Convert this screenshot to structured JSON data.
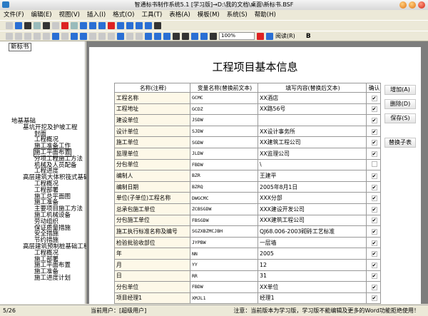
{
  "window": {
    "title": "智通标书制作系统5.1 [学习版]→D:\\我的文档\\桌面\\新标书.BSF"
  },
  "menu": [
    "文件(F)",
    "编辑(E)",
    "视图(V)",
    "插入(I)",
    "格式(O)",
    "工具(T)",
    "表格(A)",
    "模板(M)",
    "系统(S)",
    "帮助(H)"
  ],
  "toolbar": {
    "zoom": "100%",
    "read_label": "阅读(R)",
    "bold": "B"
  },
  "left": {
    "doc_tag": "新标书",
    "tree": [
      {
        "level": 1,
        "label": "地基基础"
      },
      {
        "level": 2,
        "label": "基坑开挖及护坡工程"
      },
      {
        "level": 3,
        "label": "封面"
      },
      {
        "level": 3,
        "label": "工程概况"
      },
      {
        "level": 3,
        "label": "施工准备工作"
      },
      {
        "level": 3,
        "label": "施工平面布置",
        "selected": true
      },
      {
        "level": 3,
        "label": "分项工程施工方法"
      },
      {
        "level": 3,
        "label": "机械及人员配备"
      },
      {
        "level": 3,
        "label": "工程进度"
      },
      {
        "level": 2,
        "label": "高层建筑大体积筏式基础"
      },
      {
        "level": 3,
        "label": "工程概况"
      },
      {
        "level": 3,
        "label": "工程部署"
      },
      {
        "level": 3,
        "label": "施工总平面图"
      },
      {
        "level": 3,
        "label": "施工准备"
      },
      {
        "level": 3,
        "label": "主要项目施工方法"
      },
      {
        "level": 3,
        "label": "施工机械设备"
      },
      {
        "level": 3,
        "label": "劳动组织"
      },
      {
        "level": 3,
        "label": "保证质量措施"
      },
      {
        "level": 3,
        "label": "安全措施"
      },
      {
        "level": 3,
        "label": "节约措施"
      },
      {
        "level": 2,
        "label": "高层建筑预制桩基础工程"
      },
      {
        "level": 3,
        "label": "工程概况"
      },
      {
        "level": 3,
        "label": "施工部署"
      },
      {
        "level": 3,
        "label": "施工平面布置"
      },
      {
        "level": 3,
        "label": "施工准备"
      },
      {
        "level": 3,
        "label": "施工进度计划"
      }
    ]
  },
  "main": {
    "title": "工程项目基本信息",
    "headers": [
      "名称(注释)",
      "变量名称(替换前文本)",
      "填写内容(替换后文本)",
      "确认"
    ],
    "rows": [
      [
        "工程名称",
        "GCMC",
        "XX酒店",
        true
      ],
      [
        "工程地址",
        "GCDZ",
        "XX路56号",
        true
      ],
      [
        "建设单位",
        "JSDW",
        "",
        true
      ],
      [
        "设计单位",
        "SJDW",
        "XX设计事务所",
        true
      ],
      [
        "施工单位",
        "SGDW",
        "XX建筑工程公司",
        true
      ],
      [
        "监理单位",
        "JLDW",
        "XX监理公司",
        true
      ],
      [
        "分包单位",
        "FBDW",
        "\\",
        false
      ],
      [
        "编制人",
        "BZR",
        "王建平",
        true
      ],
      [
        "编制日期",
        "BZRQ",
        "2005年8月1日",
        true
      ],
      [
        "单位(子单位)工程名称",
        "DWGCMC",
        "XXX分部",
        true
      ],
      [
        "总承包施工单位",
        "ZCBSGDW",
        "XXX建设开发公司",
        true
      ],
      [
        "分包施工单位",
        "FBSGDW",
        "XXX建筑工程公司",
        true
      ],
      [
        "施工执行标准名称及编号",
        "SGZXBZMCJBH",
        "QJ68.006-2003砌砖工艺标准",
        true
      ],
      [
        "检验批验收部位",
        "JYPBW",
        "一层墙",
        true
      ],
      [
        "年",
        "NN",
        "2005",
        true
      ],
      [
        "月",
        "YY",
        "12",
        true
      ],
      [
        "日",
        "RR",
        "31",
        true
      ],
      [
        "分包单位",
        "FBDW",
        "XX单位",
        true
      ],
      [
        "项目经理1",
        "XMJL1",
        "经理1",
        true
      ]
    ],
    "buttons": {
      "add": "增加(A)",
      "delete": "删除(D)",
      "save": "保存(S)",
      "replace": "替换子表"
    }
  },
  "status": {
    "page": "5/26",
    "user": "当前用户：[超级用户]",
    "notice": "注意：当前版本为学习版，学习版不能编辑及更多的Word功能拒绝使用！"
  }
}
